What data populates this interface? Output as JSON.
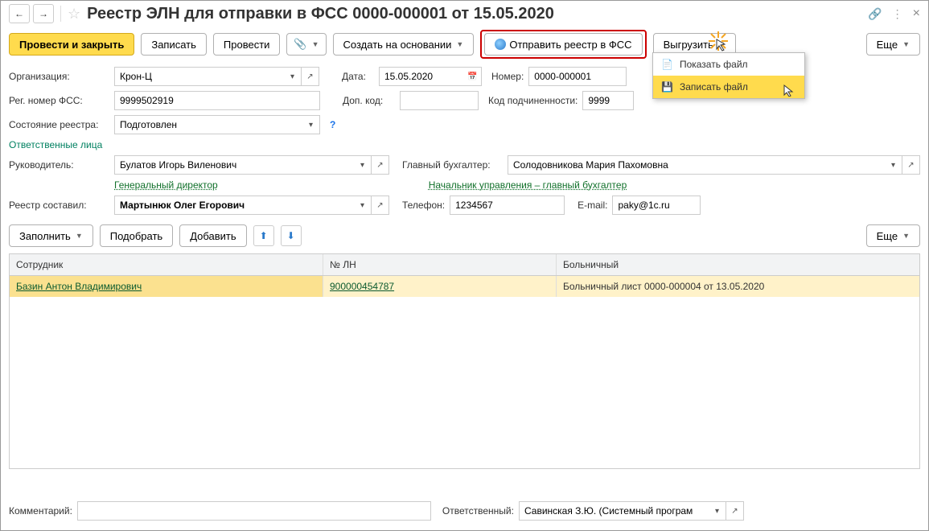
{
  "title": "Реестр ЭЛН для отправки в ФСС 0000-000001 от 15.05.2020",
  "toolbar": {
    "post_close": "Провести и закрыть",
    "save": "Записать",
    "post": "Провести",
    "create_based": "Создать на основании",
    "send_fss": "Отправить реестр в ФСС",
    "export": "Выгрузить",
    "more": "Еще"
  },
  "popup": {
    "show_file": "Показать файл",
    "write_file": "Записать файл"
  },
  "labels": {
    "org": "Организация:",
    "date": "Дата:",
    "number": "Номер:",
    "reg_fss": "Рег. номер ФСС:",
    "dop_code": "Доп. код:",
    "subord": "Код подчиненности:",
    "state": "Состояние реестра:",
    "resp_persons": "Ответственные лица",
    "head": "Руководитель:",
    "chief_acc": "Главный бухгалтер:",
    "head_link": "Генеральный директор",
    "acc_link": "Начальник управления – главный бухгалтер",
    "compiled_by": "Реестр составил:",
    "phone": "Телефон:",
    "email": "E-mail:",
    "comment": "Комментарий:",
    "responsible": "Ответственный:"
  },
  "values": {
    "org": "Крон-Ц",
    "date": "15.05.2020",
    "number": "0000-000001",
    "reg_fss": "9999502919",
    "dop_code": "",
    "subord": "9999",
    "state": "Подготовлен",
    "head": "Булатов Игорь Виленович",
    "chief_acc": "Солодовникова Мария Пахомовна",
    "compiled_by": "Мартынюк Олег Егорович",
    "phone": "1234567",
    "email": "paky@1c.ru",
    "comment": "",
    "responsible": "Савинская З.Ю. (Системный програм"
  },
  "tabletoolbar": {
    "fill": "Заполнить",
    "pick": "Подобрать",
    "add": "Добавить",
    "more": "Еще"
  },
  "table": {
    "cols": {
      "c1": "Сотрудник",
      "c2": "№ ЛН",
      "c3": "Больничный"
    },
    "rows": [
      {
        "c1": "Базин Антон Владимирович",
        "c2": "900000454787",
        "c3": "Больничный лист 0000-000004 от 13.05.2020"
      }
    ]
  }
}
